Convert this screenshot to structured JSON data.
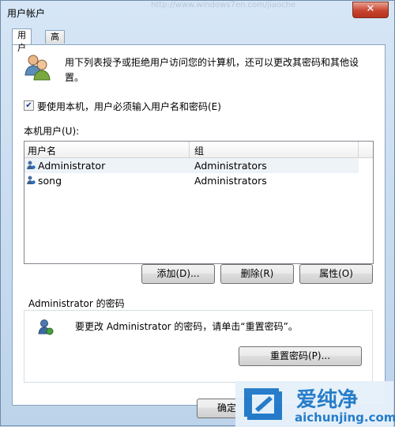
{
  "window": {
    "title": "用户帐户",
    "background_url_ghost": "http://www.windows7en.com/jiaoche",
    "close_symbol": "✕"
  },
  "tabs": [
    {
      "label": "用户",
      "active": true
    },
    {
      "label": "高级",
      "active": false
    }
  ],
  "intro": {
    "line1": "用下列表授予或拒绝用户访问您的计算机，还可以更改其密码和其他设",
    "line2": "置。"
  },
  "require_login": {
    "checked": true,
    "check_glyph": "✔",
    "label": "要使用本机，用户必须输入用户名和密码(E)"
  },
  "users_section": {
    "label": "本机用户(U):",
    "columns": [
      "用户名",
      "组"
    ],
    "rows": [
      {
        "username": "Administrator",
        "group": "Administrators",
        "selected": true
      },
      {
        "username": "song",
        "group": "Administrators",
        "selected": false
      }
    ]
  },
  "buttons": {
    "add": "添加(D)...",
    "remove": "删除(R)",
    "properties": "属性(O)"
  },
  "password_section": {
    "title": "Administrator 的密码",
    "message": "要更改 Administrator 的密码，请单击“重置密码”。",
    "reset_button": "重置密码(P)..."
  },
  "footer": {
    "ok_button": "确定"
  },
  "watermark": {
    "brand": "爱纯净",
    "url": "aichunjing.com"
  },
  "colors": {
    "title_bar": "#cfe0f1",
    "close_button": "#c7452f",
    "accent_blue": "#1a73c9"
  }
}
